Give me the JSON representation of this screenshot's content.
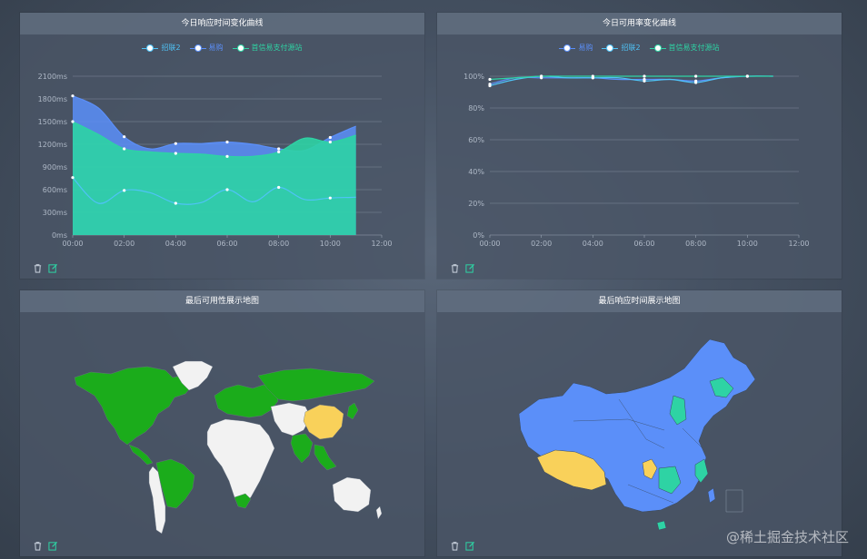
{
  "panels": {
    "response_time": {
      "title": "今日响应时间变化曲线",
      "legend": [
        {
          "name": "招联2",
          "color": "#4fc3f7"
        },
        {
          "name": "易购",
          "color": "#5b8ff9"
        },
        {
          "name": "首信易支付源站",
          "color": "#2ed3a4"
        }
      ]
    },
    "availability": {
      "title": "今日可用率变化曲线",
      "legend": [
        {
          "name": "易购",
          "color": "#5b8ff9"
        },
        {
          "name": "招联2",
          "color": "#4fc3f7"
        },
        {
          "name": "首信易支付源站",
          "color": "#2ed3a4"
        }
      ]
    },
    "world_map": {
      "title": "最后可用性展示地图"
    },
    "china_map": {
      "title": "最后响应时间展示地图"
    }
  },
  "toolbar": {
    "delete_icon": "trash-icon",
    "edit_icon": "edit-icon"
  },
  "watermark": "@稀土掘金技术社区",
  "chart_data": [
    {
      "type": "area",
      "title": "今日响应时间变化曲线",
      "x": [
        "00:00",
        "01:00",
        "02:00",
        "03:00",
        "04:00",
        "05:00",
        "06:00",
        "07:00",
        "08:00",
        "09:00",
        "10:00",
        "11:00"
      ],
      "xticks": [
        "00:00",
        "02:00",
        "04:00",
        "06:00",
        "08:00",
        "10:00",
        "12:00"
      ],
      "yticks": [
        "0ms",
        "300ms",
        "600ms",
        "900ms",
        "1200ms",
        "1500ms",
        "1800ms",
        "2100ms"
      ],
      "ylim": [
        0,
        2100
      ],
      "xlim_hours": [
        0,
        12
      ],
      "series": [
        {
          "name": "易购",
          "color": "#5b8ff9",
          "values": [
            1840,
            1680,
            1300,
            1140,
            1210,
            1210,
            1230,
            1200,
            1140,
            1120,
            1290,
            1440
          ]
        },
        {
          "name": "首信易支付源站",
          "color": "#2ed3a4",
          "values": [
            1500,
            1330,
            1140,
            1100,
            1080,
            1070,
            1040,
            1040,
            1100,
            1280,
            1230,
            1320
          ]
        },
        {
          "name": "招联2",
          "color": "#4fc3f7",
          "values": [
            760,
            420,
            590,
            560,
            420,
            430,
            600,
            440,
            630,
            470,
            490,
            500
          ]
        }
      ]
    },
    {
      "type": "line",
      "title": "今日可用率变化曲线",
      "x": [
        "00:00",
        "01:00",
        "02:00",
        "03:00",
        "04:00",
        "05:00",
        "06:00",
        "07:00",
        "08:00",
        "09:00",
        "10:00",
        "11:00"
      ],
      "xticks": [
        "00:00",
        "02:00",
        "04:00",
        "06:00",
        "08:00",
        "10:00",
        "12:00"
      ],
      "yticks": [
        "0%",
        "20%",
        "40%",
        "60%",
        "80%",
        "100%"
      ],
      "ylim": [
        0,
        100
      ],
      "xlim_hours": [
        0,
        12
      ],
      "series": [
        {
          "name": "易购",
          "color": "#5b8ff9",
          "values": [
            95,
            99,
            99,
            99,
            99,
            98,
            98,
            98,
            97,
            99,
            100,
            100
          ]
        },
        {
          "name": "招联2",
          "color": "#4fc3f7",
          "values": [
            94,
            98,
            100,
            99,
            99,
            99,
            97,
            98,
            96,
            99,
            100,
            100
          ]
        },
        {
          "name": "首信易支付源站",
          "color": "#2ed3a4",
          "values": [
            98,
            99,
            100,
            100,
            100,
            100,
            100,
            100,
            100,
            100,
            100,
            100
          ]
        }
      ]
    }
  ]
}
